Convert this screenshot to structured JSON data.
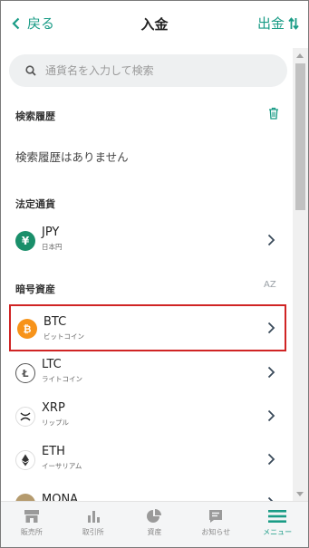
{
  "header": {
    "back_label": "戻る",
    "title": "入金",
    "withdraw_label": "出金"
  },
  "search": {
    "placeholder": "通貨名を入力して検索"
  },
  "history": {
    "section_title": "検索履歴",
    "empty_text": "検索履歴はありません"
  },
  "fiat": {
    "section_title": "法定通貨",
    "items": [
      {
        "symbol": "JPY",
        "name": "日本円",
        "icon": "yen-icon",
        "color": "#1a8f6a"
      }
    ]
  },
  "crypto": {
    "section_title": "暗号資産",
    "sort_label": "AZ",
    "items": [
      {
        "symbol": "BTC",
        "name": "ビットコイン",
        "icon": "bitcoin-icon",
        "color": "#f7931a",
        "selected": true
      },
      {
        "symbol": "LTC",
        "name": "ライトコイン",
        "icon": "litecoin-icon",
        "color": "#555555"
      },
      {
        "symbol": "XRP",
        "name": "リップル",
        "icon": "xrp-icon",
        "color": "#222222"
      },
      {
        "symbol": "ETH",
        "name": "イーサリアム",
        "icon": "ethereum-icon",
        "color": "#333333"
      },
      {
        "symbol": "MONA",
        "name": "",
        "icon": "monacoin-icon",
        "color": "#b59b6e"
      }
    ]
  },
  "nav": {
    "items": [
      {
        "label": "販売所",
        "icon": "store-icon"
      },
      {
        "label": "取引所",
        "icon": "exchange-chart-icon"
      },
      {
        "label": "資産",
        "icon": "pie-chart-icon"
      },
      {
        "label": "お知らせ",
        "icon": "message-icon"
      },
      {
        "label": "メニュー",
        "icon": "menu-icon",
        "active": true
      }
    ]
  },
  "colors": {
    "accent": "#1a9c86",
    "highlight_border": "#d02424"
  }
}
